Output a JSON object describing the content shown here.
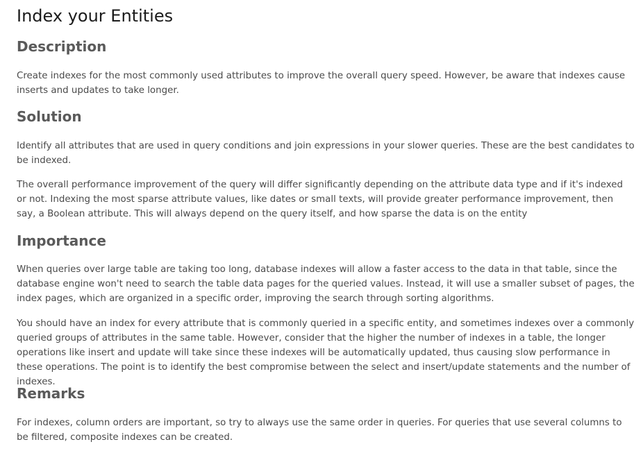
{
  "page": {
    "title": "Index your Entities"
  },
  "sections": [
    {
      "heading": "Description",
      "paragraphs": [
        "Create indexes for the most commonly used attributes to improve the overall query speed. However, be aware that indexes cause inserts and updates to take longer."
      ]
    },
    {
      "heading": "Solution",
      "paragraphs": [
        "Identify all attributes that are used in query conditions and join expressions in your slower queries. These are the best candidates to be indexed.",
        "The overall performance improvement of the query will differ significantly depending on the attribute data type and if it's indexed or not. Indexing the most sparse attribute values, like dates or small texts, will provide greater performance improvement, then say, a Boolean attribute. This will always depend on the query itself, and how sparse the data is on the entity"
      ]
    },
    {
      "heading": "Importance",
      "paragraphs": [
        "When queries over large table are taking too long, database indexes will allow a faster access to the data in that table, since the database engine won't need to search the table data pages for the queried values. Instead, it will use a smaller subset of pages, the index pages, which are organized in a specific order, improving the search through sorting algorithms.",
        "You should have an index for every attribute that is commonly queried in a specific entity, and sometimes indexes over a commonly queried groups of attributes in the same table. However, consider that the higher the number of indexes in a table, the longer operations like insert and update will take since these indexes will be automatically updated, thus causing slow performance in these operations. The point is to identify the best compromise between the select and insert/update statements and the number of indexes."
      ]
    },
    {
      "heading": "Remarks",
      "paragraphs": [
        "For indexes, column orders are important, so try to always use the same order in queries. For queries that use several columns to be filtered, composite indexes can be created."
      ]
    }
  ]
}
